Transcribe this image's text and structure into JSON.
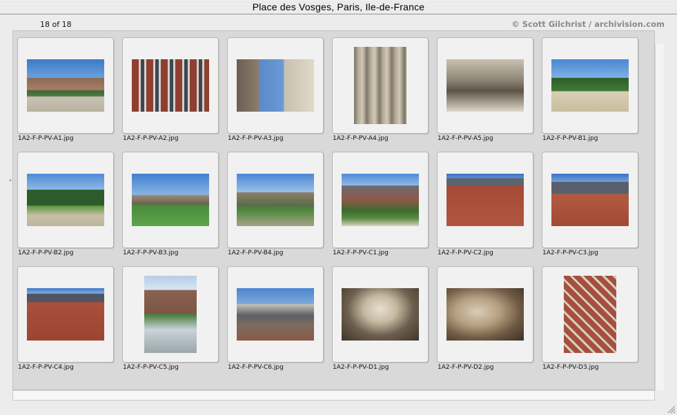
{
  "window": {
    "title": "Place des Vosges, Paris, Ile-de-France"
  },
  "header": {
    "count": "18 of 18",
    "credit": "© Scott Gilchrist / archivision.com"
  },
  "thumbnails": [
    {
      "filename": "1A2-F-P-PV-A1.jpg"
    },
    {
      "filename": "1A2-F-P-PV-A2.jpg"
    },
    {
      "filename": "1A2-F-P-PV-A3.jpg"
    },
    {
      "filename": "1A2-F-P-PV-A4.jpg"
    },
    {
      "filename": "1A2-F-P-PV-A5.jpg"
    },
    {
      "filename": "1A2-F-P-PV-B1.jpg"
    },
    {
      "filename": "1A2-F-P-PV-B2.jpg"
    },
    {
      "filename": "1A2-F-P-PV-B3.jpg"
    },
    {
      "filename": "1A2-F-P-PV-B4.jpg"
    },
    {
      "filename": "1A2-F-P-PV-C1.jpg"
    },
    {
      "filename": "1A2-F-P-PV-C2.jpg"
    },
    {
      "filename": "1A2-F-P-PV-C3.jpg"
    },
    {
      "filename": "1A2-F-P-PV-C4.jpg"
    },
    {
      "filename": "1A2-F-P-PV-C5.jpg"
    },
    {
      "filename": "1A2-F-P-PV-C6.jpg"
    },
    {
      "filename": "1A2-F-P-PV-D1.jpg"
    },
    {
      "filename": "1A2-F-P-PV-D2.jpg"
    },
    {
      "filename": "1A2-F-P-PV-D3.jpg"
    }
  ]
}
